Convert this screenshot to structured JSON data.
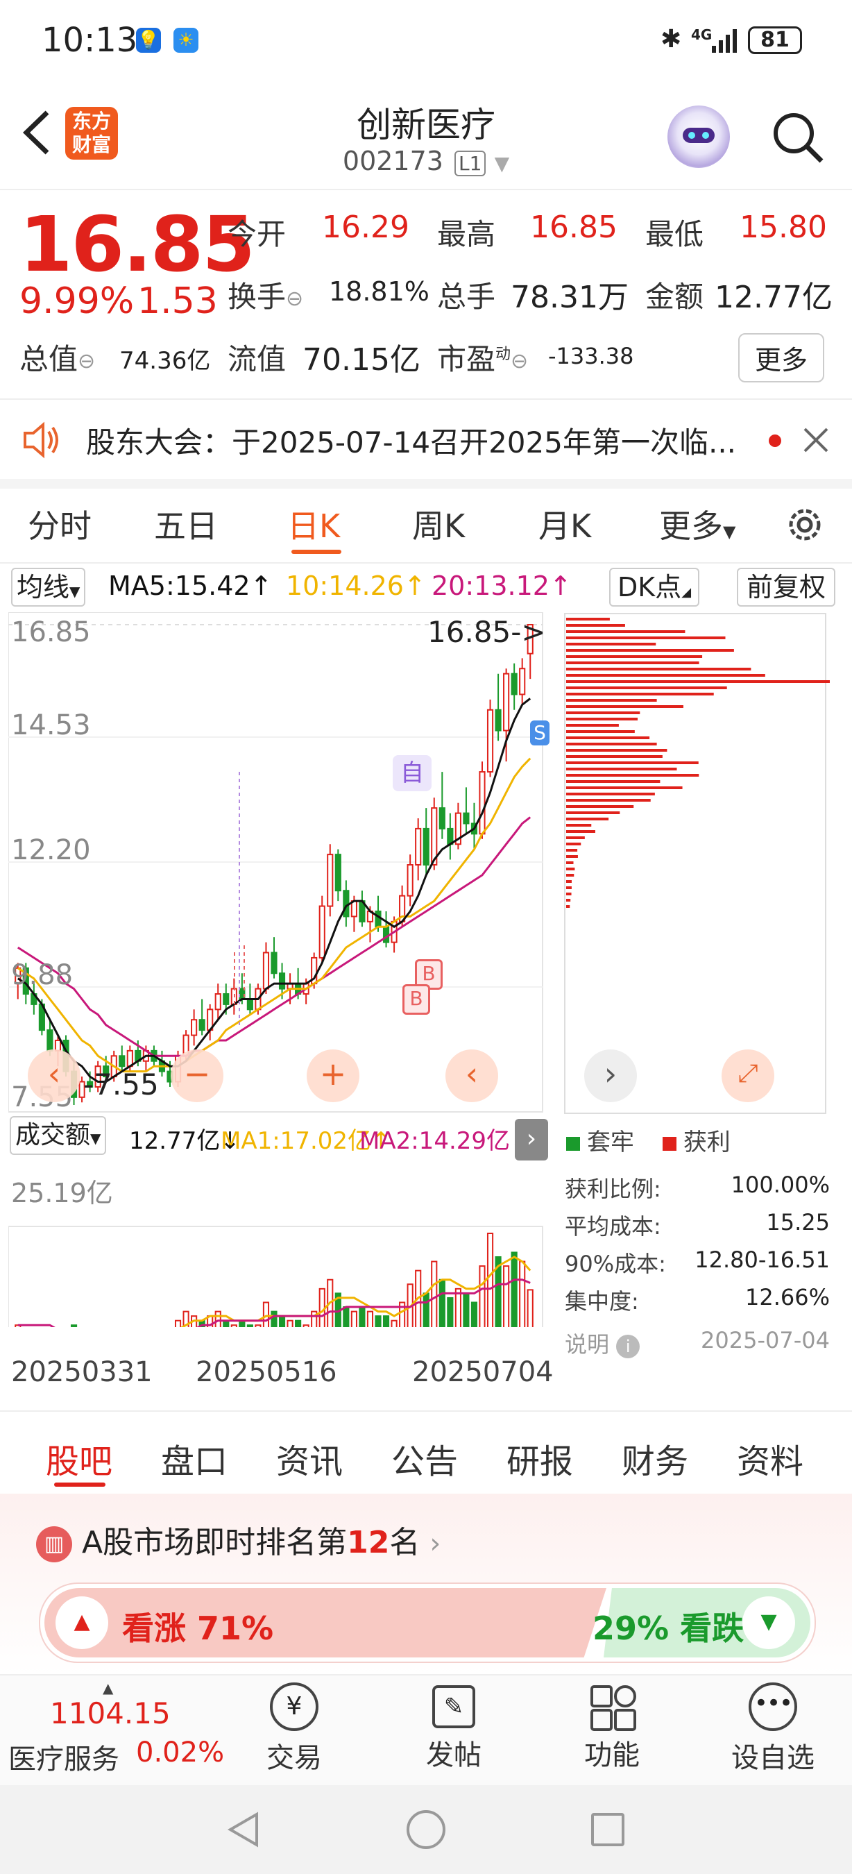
{
  "status": {
    "time": "10:13",
    "net": "4G",
    "battery": "81"
  },
  "header": {
    "title": "创新医疗",
    "code": "002173",
    "level": "L1",
    "logo_line1": "东方",
    "logo_line2": "财富"
  },
  "quote": {
    "price": "16.85",
    "change_pct": "9.99%",
    "change": "1.53",
    "rows": [
      {
        "l1": "今开",
        "v1": "16.29",
        "l2": "最高",
        "v2": "16.85",
        "l3": "最低",
        "v3": "15.80"
      },
      {
        "l1": "换手",
        "v1": "18.81%",
        "l2": "总手",
        "v2": "78.31万",
        "l3": "金额",
        "v3": "12.77亿"
      }
    ],
    "mktcap_label": "总值",
    "mktcap": "74.36亿",
    "float_label": "流值",
    "float": "70.15亿",
    "pe_label": "市盈",
    "pe_sup": "动",
    "pe": "-133.38",
    "more": "更多"
  },
  "notice": {
    "text": "股东大会：于2025-07-14召开2025年第一次临..."
  },
  "ktabs": [
    "分时",
    "五日",
    "日K",
    "周K",
    "月K",
    "更多"
  ],
  "ma_bar": {
    "select": "均线",
    "ma5": "MA5:15.42↑",
    "ma10": "10:14.26↑",
    "ma20": "20:13.12↑",
    "dk": "DK点",
    "adj": "前复权"
  },
  "price_axis": [
    "16.85",
    "14.53",
    "12.20",
    "9.88",
    "7.55"
  ],
  "annotations": {
    "high": "16.85->",
    "low": "-7.55",
    "zi": "自",
    "b": "B",
    "s": "S"
  },
  "vol_bar": {
    "select": "成交额",
    "val": "12.77亿↓",
    "ma1": "MA1:17.02亿↑",
    "ma2": "MA2:14.29亿↓"
  },
  "vol_max": "25.19亿",
  "dates": [
    "20250331",
    "20250516",
    "20250704"
  ],
  "chip": {
    "legend1": "套牢",
    "legend2": "获利",
    "rows": [
      {
        "label": "获利比例:",
        "value": "100.00%"
      },
      {
        "label": "平均成本:",
        "value": "15.25"
      },
      {
        "label": "90%成本:",
        "value": "12.80-16.51"
      },
      {
        "label": "集中度:",
        "value": "12.66%"
      }
    ],
    "note": "说明",
    "date": "2025-07-04"
  },
  "ftabs": [
    "股吧",
    "盘口",
    "资讯",
    "公告",
    "研报",
    "财务",
    "资料"
  ],
  "rank": {
    "prefix": "A股市场即时排名第",
    "num": "12",
    "suffix": "名",
    "up": "看涨 71%",
    "down": "29% 看跌"
  },
  "index": {
    "value": "1104.15",
    "name": "医疗服务",
    "pct": "0.02%"
  },
  "bottom_nav": [
    "交易",
    "发帖",
    "功能",
    "设自选"
  ],
  "colors": {
    "up": "#e0221b",
    "down": "#1a9a2c",
    "ma5": "#111111",
    "ma10": "#f0b400",
    "ma20": "#c8187a"
  },
  "chart_data": {
    "type": "candlestick",
    "price_range": [
      7.55,
      16.85
    ],
    "candles": [
      [
        9.9,
        10.3,
        9.6,
        10.2
      ],
      [
        10.2,
        10.3,
        9.5,
        9.7
      ],
      [
        9.7,
        9.9,
        9.3,
        9.5
      ],
      [
        9.5,
        9.6,
        8.9,
        9.0
      ],
      [
        9.0,
        9.2,
        8.5,
        8.6
      ],
      [
        8.6,
        8.9,
        8.3,
        8.8
      ],
      [
        8.8,
        8.9,
        8.1,
        8.2
      ],
      [
        8.2,
        8.4,
        7.55,
        7.7
      ],
      [
        7.7,
        8.1,
        7.6,
        8.0
      ],
      [
        8.0,
        8.2,
        7.8,
        7.9
      ],
      [
        7.9,
        8.4,
        7.8,
        8.3
      ],
      [
        8.3,
        8.5,
        8.0,
        8.1
      ],
      [
        8.1,
        8.6,
        8.0,
        8.5
      ],
      [
        8.5,
        8.7,
        8.2,
        8.3
      ],
      [
        8.3,
        8.7,
        8.2,
        8.6
      ],
      [
        8.6,
        8.8,
        8.3,
        8.4
      ],
      [
        8.4,
        8.7,
        8.2,
        8.6
      ],
      [
        8.6,
        8.7,
        8.3,
        8.4
      ],
      [
        8.4,
        8.6,
        8.1,
        8.2
      ],
      [
        8.2,
        8.4,
        7.9,
        8.0
      ],
      [
        8.0,
        8.6,
        7.9,
        8.5
      ],
      [
        8.5,
        9.0,
        8.4,
        8.9
      ],
      [
        8.9,
        9.4,
        8.7,
        9.2
      ],
      [
        9.2,
        9.6,
        8.9,
        9.0
      ],
      [
        9.0,
        9.5,
        8.8,
        9.4
      ],
      [
        9.4,
        9.9,
        9.2,
        9.7
      ],
      [
        9.7,
        9.9,
        9.3,
        9.5
      ],
      [
        9.5,
        10.0,
        9.3,
        9.8
      ],
      [
        9.8,
        10.1,
        9.5,
        9.6
      ],
      [
        9.6,
        9.9,
        9.3,
        9.4
      ],
      [
        9.4,
        9.9,
        9.3,
        9.8
      ],
      [
        9.8,
        10.7,
        9.7,
        10.5
      ],
      [
        10.5,
        10.8,
        10.0,
        10.1
      ],
      [
        10.1,
        10.3,
        9.6,
        9.8
      ],
      [
        9.8,
        10.1,
        9.5,
        9.9
      ],
      [
        9.9,
        10.2,
        9.6,
        9.7
      ],
      [
        9.7,
        10.0,
        9.5,
        9.9
      ],
      [
        9.9,
        10.5,
        9.8,
        10.4
      ],
      [
        10.4,
        11.6,
        10.3,
        11.4
      ],
      [
        11.4,
        12.6,
        11.2,
        12.4
      ],
      [
        12.4,
        12.5,
        11.5,
        11.7
      ],
      [
        11.7,
        11.9,
        11.0,
        11.2
      ],
      [
        11.2,
        11.6,
        10.9,
        11.5
      ],
      [
        11.5,
        11.7,
        11.0,
        11.1
      ],
      [
        11.1,
        11.4,
        10.7,
        11.3
      ],
      [
        11.3,
        11.6,
        10.9,
        11.0
      ],
      [
        11.0,
        11.3,
        10.6,
        10.7
      ],
      [
        10.7,
        11.2,
        10.5,
        11.1
      ],
      [
        11.1,
        11.8,
        11.0,
        11.6
      ],
      [
        11.6,
        12.4,
        11.4,
        12.2
      ],
      [
        12.2,
        13.1,
        11.9,
        12.9
      ],
      [
        12.9,
        13.3,
        12.0,
        12.2
      ],
      [
        12.2,
        13.5,
        12.1,
        13.3
      ],
      [
        13.3,
        14.0,
        12.7,
        12.9
      ],
      [
        12.9,
        13.2,
        12.3,
        12.6
      ],
      [
        12.6,
        13.4,
        12.5,
        13.2
      ],
      [
        13.2,
        13.7,
        12.8,
        13.0
      ],
      [
        13.0,
        13.4,
        12.5,
        12.8
      ],
      [
        12.8,
        14.2,
        12.7,
        14.0
      ],
      [
        14.0,
        15.4,
        13.9,
        15.2
      ],
      [
        15.2,
        15.9,
        14.6,
        14.8
      ],
      [
        14.8,
        16.0,
        14.2,
        15.9
      ],
      [
        15.9,
        16.1,
        15.2,
        15.5
      ],
      [
        15.5,
        16.2,
        15.3,
        16.0
      ],
      [
        16.29,
        16.85,
        15.8,
        16.85
      ]
    ],
    "ma5": [
      10.0,
      9.9,
      9.7,
      9.5,
      9.2,
      8.9,
      8.6,
      8.4,
      8.3,
      8.1,
      8.0,
      8.0,
      8.1,
      8.2,
      8.3,
      8.4,
      8.5,
      8.5,
      8.4,
      8.3,
      8.3,
      8.4,
      8.6,
      8.8,
      9.0,
      9.2,
      9.4,
      9.5,
      9.6,
      9.6,
      9.6,
      9.8,
      9.9,
      9.9,
      9.9,
      9.9,
      9.9,
      10.0,
      10.3,
      10.7,
      11.1,
      11.4,
      11.5,
      11.5,
      11.3,
      11.2,
      11.1,
      11.0,
      11.1,
      11.3,
      11.6,
      12.0,
      12.3,
      12.5,
      12.6,
      12.7,
      12.8,
      12.9,
      13.2,
      13.6,
      14.1,
      14.6,
      15.0,
      15.3,
      15.42
    ],
    "ma10": [
      10.2,
      10.1,
      10.0,
      9.8,
      9.6,
      9.4,
      9.2,
      9.0,
      8.8,
      8.7,
      8.5,
      8.4,
      8.3,
      8.2,
      8.2,
      8.2,
      8.2,
      8.3,
      8.3,
      8.3,
      8.3,
      8.4,
      8.5,
      8.6,
      8.7,
      8.8,
      9.0,
      9.1,
      9.2,
      9.3,
      9.4,
      9.5,
      9.6,
      9.7,
      9.8,
      9.8,
      9.8,
      9.9,
      10.0,
      10.2,
      10.4,
      10.6,
      10.7,
      10.8,
      10.9,
      11.0,
      11.0,
      11.1,
      11.2,
      11.2,
      11.3,
      11.4,
      11.5,
      11.7,
      11.9,
      12.1,
      12.3,
      12.5,
      12.8,
      13.0,
      13.3,
      13.6,
      13.9,
      14.1,
      14.26
    ],
    "ma20": [
      10.6,
      10.5,
      10.4,
      10.3,
      10.2,
      10.1,
      9.9,
      9.8,
      9.6,
      9.4,
      9.3,
      9.1,
      9.0,
      8.9,
      8.8,
      8.7,
      8.6,
      8.5,
      8.5,
      8.5,
      8.5,
      8.5,
      8.6,
      8.6,
      8.7,
      8.8,
      8.8,
      8.9,
      9.0,
      9.1,
      9.2,
      9.3,
      9.4,
      9.5,
      9.6,
      9.7,
      9.8,
      9.9,
      10.0,
      10.1,
      10.2,
      10.3,
      10.4,
      10.5,
      10.6,
      10.7,
      10.8,
      10.9,
      11.0,
      11.1,
      11.2,
      11.3,
      11.4,
      11.5,
      11.6,
      11.7,
      11.8,
      11.9,
      12.0,
      12.2,
      12.4,
      12.6,
      12.8,
      13.0,
      13.12
    ],
    "volume": [
      5,
      4,
      3,
      3,
      4,
      3,
      3,
      5,
      3,
      2,
      3,
      2,
      4,
      3,
      4,
      3,
      3,
      2,
      2,
      2,
      6,
      8,
      7,
      6,
      7,
      8,
      6,
      5,
      6,
      5,
      5,
      10,
      8,
      7,
      6,
      6,
      5,
      8,
      13,
      15,
      12,
      9,
      8,
      9,
      8,
      7,
      7,
      6,
      10,
      14,
      17,
      12,
      19,
      15,
      11,
      13,
      12,
      10,
      18,
      25.19,
      20,
      18,
      21,
      19,
      12.77
    ],
    "vol_ma1": [
      4,
      4,
      4,
      4,
      4,
      4,
      4,
      4,
      3,
      3,
      3,
      3,
      3,
      3,
      3,
      3,
      3,
      3,
      3,
      3,
      4,
      5,
      6,
      6,
      7,
      7,
      7,
      6,
      6,
      6,
      6,
      7,
      7,
      7,
      7,
      7,
      7,
      7,
      8,
      10,
      11,
      11,
      11,
      10,
      9,
      8,
      8,
      7,
      8,
      9,
      11,
      12,
      14,
      15,
      15,
      14,
      13,
      13,
      14,
      16,
      18,
      19,
      20,
      19,
      17.02
    ],
    "vol_ma2": [
      5,
      5,
      5,
      5,
      5,
      4,
      4,
      4,
      4,
      4,
      4,
      3,
      3,
      3,
      3,
      3,
      3,
      3,
      3,
      3,
      3,
      4,
      4,
      5,
      5,
      6,
      6,
      6,
      6,
      6,
      6,
      6,
      7,
      7,
      7,
      7,
      7,
      7,
      7,
      8,
      8,
      9,
      9,
      9,
      9,
      9,
      9,
      9,
      9,
      9,
      10,
      10,
      11,
      12,
      12,
      12,
      12,
      12,
      13,
      13,
      14,
      14,
      15,
      15,
      14.29
    ],
    "chip_profile": [
      0.2,
      0.5,
      0.55,
      0.35,
      0.6,
      0.5,
      0.65,
      0.8,
      0.95,
      0.7,
      0.5,
      0.4,
      0.3,
      0.25,
      0.2,
      0.25,
      0.3,
      0.35,
      0.4,
      0.45,
      0.5,
      0.45,
      0.4,
      0.35,
      0.3,
      0.25,
      0.2,
      0.15,
      0.1,
      0.08,
      0.05,
      0.05,
      0.04,
      0.03,
      0.03,
      0.02,
      0.02,
      0.02,
      0.015,
      0.015
    ]
  }
}
